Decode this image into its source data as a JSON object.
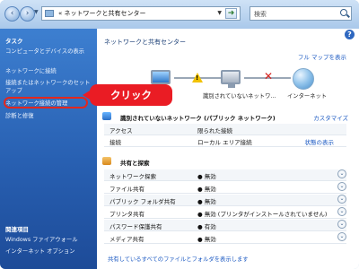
{
  "titlebar": {
    "breadcrumb": "« ネットワークと共有センター",
    "search_placeholder": "検索"
  },
  "sidebar": {
    "task_title": "タスク",
    "items": [
      "コンピュータとデバイスの表示",
      "ネットワークに接続",
      "接続またはネットワークのセットアップ",
      "ネットワーク接続の管理",
      "診断と修復"
    ],
    "related_title": "関連項目",
    "related_items": [
      "Windows ファイアウォール",
      "インターネット オプション"
    ]
  },
  "main": {
    "title": "ネットワークと共有センター",
    "full_map": "フル マップを表示",
    "network": {
      "unknown_caption": "識別されていないネットワ...",
      "internet_caption": "インターネット"
    },
    "callout": "クリック",
    "network_section": {
      "title": "識別されていないネットワーク (パブリック ネットワーク)",
      "customize": "カスタマイズ",
      "rows": [
        {
          "label": "アクセス",
          "value": "限られた接続"
        },
        {
          "label": "接続",
          "value": "ローカル エリア接続",
          "link": "状態の表示"
        }
      ]
    },
    "sharing": {
      "title": "共有と探索",
      "rows": [
        {
          "label": "ネットワーク探索",
          "value": "● 無効"
        },
        {
          "label": "ファイル共有",
          "value": "● 無効"
        },
        {
          "label": "パブリック フォルダ共有",
          "value": "● 無効"
        },
        {
          "label": "プリンタ共有",
          "value": "● 無効 (プリンタがインストールされていません)"
        },
        {
          "label": "パスワード保護共有",
          "value": "● 有効"
        },
        {
          "label": "メディア共有",
          "value": "● 無効"
        }
      ]
    },
    "footer_link": "共有しているすべてのファイルとフォルダを表示します"
  }
}
